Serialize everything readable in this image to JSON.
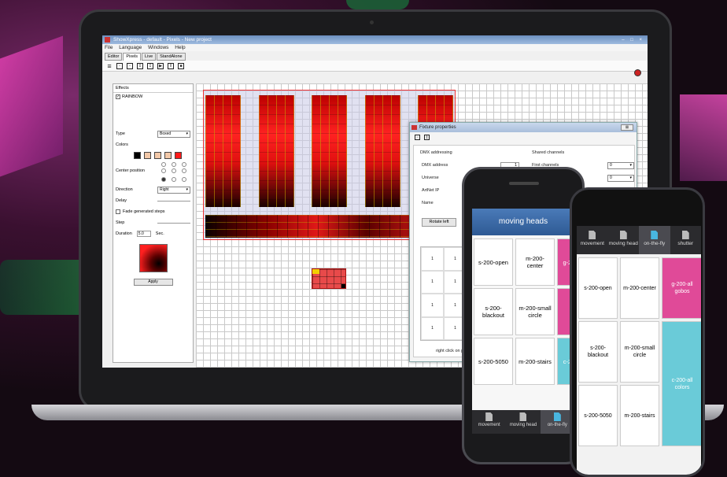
{
  "app": {
    "title": "ShowXpress - default - Pixels - New project",
    "window_buttons": "– □ ×",
    "menu": [
      "File",
      "Language",
      "Windows",
      "Help"
    ],
    "tabs": [
      "Editor",
      "Pixels",
      "Live",
      "StandAlone"
    ],
    "active_tab": "Pixels"
  },
  "effects": {
    "header": "Effects",
    "items": [
      {
        "label": "RAINBOW",
        "checked": true
      }
    ]
  },
  "properties": {
    "type_label": "Type",
    "type_value": "Boxed",
    "colors_label": "Colors",
    "center_label": "Center position",
    "direction_label": "Direction",
    "direction_value": "Right",
    "delay_label": "Delay",
    "fade_label": "Fade generated steps",
    "step_label": "Step",
    "duration_label": "Duration",
    "duration_value": "5.0",
    "duration_unit": "Sec.",
    "apply_label": "Apply",
    "swatch_colors": [
      "#000000",
      "#f2c8a8",
      "#f2c8a8",
      "#f2c8a8",
      "#ff1a1a"
    ]
  },
  "dialog": {
    "title": "Fixture properties",
    "close": "⊠",
    "dmx_addressing": "DMX addressing",
    "dmx_address_label": "DMX address",
    "dmx_address_value": "1",
    "universe_label": "Universe",
    "artnet_label": "ArtNet IP",
    "name_label": "Name",
    "shared_label": "Shared channels",
    "first_channels_label": "First channels",
    "first_channels_value": "0",
    "second_value": "0",
    "rotate_label": "Rotate left",
    "grid_values": [
      "1",
      "1",
      "1",
      "1",
      "1",
      "1",
      "1",
      "1"
    ],
    "hint": "right click on pixe"
  },
  "phone1": {
    "header": "moving heads",
    "cells": [
      "s-200-open",
      "m-200-center",
      "g-20",
      "s-200-blackout",
      "m-200-small circle",
      "s-200-5050",
      "m-200-stairs",
      "c-20"
    ],
    "nav": [
      "movement",
      "moving head",
      "on-the-fly"
    ],
    "active_nav": "on-the-fly"
  },
  "phone2": {
    "nav": [
      "movement",
      "moving head",
      "on-the-fly",
      "shutter"
    ],
    "active_nav": "on-the-fly",
    "cells": [
      "s-200-open",
      "m-200-center",
      "g-200-all gobos",
      "s-200-blackout",
      "m-200-small circle",
      "s-200-5050",
      "m-200-stairs",
      "c-200-all colors"
    ]
  }
}
